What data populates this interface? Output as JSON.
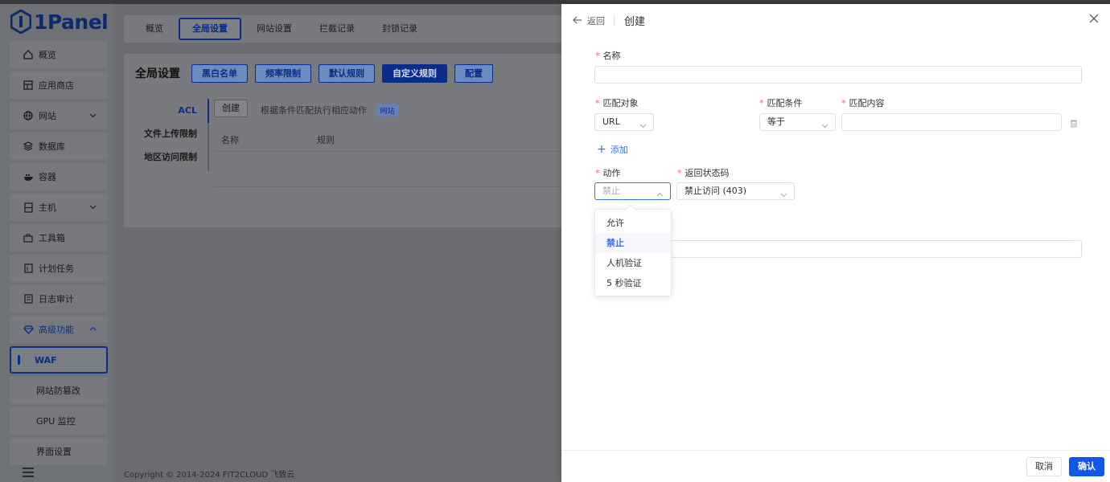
{
  "app": {
    "logo_text": "1Panel",
    "accent": "#1456e8",
    "nav_accent": "#0a2c8a"
  },
  "sidebar": {
    "items": [
      {
        "label": "概览",
        "icon": "home-icon"
      },
      {
        "label": "应用商店",
        "icon": "app-store-icon"
      },
      {
        "label": "网站",
        "icon": "globe-icon",
        "expandable": true
      },
      {
        "label": "数据库",
        "icon": "database-icon"
      },
      {
        "label": "容器",
        "icon": "docker-icon"
      },
      {
        "label": "主机",
        "icon": "server-icon",
        "expandable": true
      },
      {
        "label": "工具箱",
        "icon": "toolbox-icon"
      },
      {
        "label": "计划任务",
        "icon": "calendar-icon"
      },
      {
        "label": "日志审计",
        "icon": "log-icon"
      },
      {
        "label": "高级功能",
        "icon": "diamond-icon",
        "expanded": true
      },
      {
        "label": "WAF",
        "active": true
      },
      {
        "label": "网站防篡改"
      },
      {
        "label": "GPU 监控"
      },
      {
        "label": "界面设置"
      }
    ]
  },
  "main": {
    "tabs": [
      "概览",
      "全局设置",
      "网站设置",
      "拦截记录",
      "封锁记录"
    ],
    "active_tab": "全局设置",
    "card": {
      "title": "全局设置",
      "header_buttons": [
        "黑白名单",
        "频率限制",
        "默认规则",
        "自定义规则",
        "配置"
      ],
      "active_button": "自定义规则",
      "vtabs": [
        "ACL",
        "文件上传限制",
        "地区访问限制"
      ],
      "create_label": "创建",
      "hint": "根据条件匹配执行相应动作",
      "hint_badge": "网站",
      "columns": [
        "名称",
        "规则"
      ]
    },
    "footer": "Copyright © 2014-2024 FIT2CLOUD 飞致云"
  },
  "drawer": {
    "back_label": "返回",
    "title": "创建",
    "name_label": "名称",
    "name_value": "",
    "match_target_label": "匹配对象",
    "match_target_value": "URL",
    "match_condition_label": "匹配条件",
    "match_condition_value": "等于",
    "match_content_label": "匹配内容",
    "match_content_value": "",
    "add_label": "添加",
    "action_label": "动作",
    "action_placeholder": "禁止",
    "status_code_label": "返回状态码",
    "status_code_value": "禁止访问 (403)",
    "action_options": [
      "允许",
      "禁止",
      "人机验证",
      "5 秒验证"
    ],
    "selected_option": "禁止",
    "cancel_label": "取消",
    "confirm_label": "确认"
  }
}
